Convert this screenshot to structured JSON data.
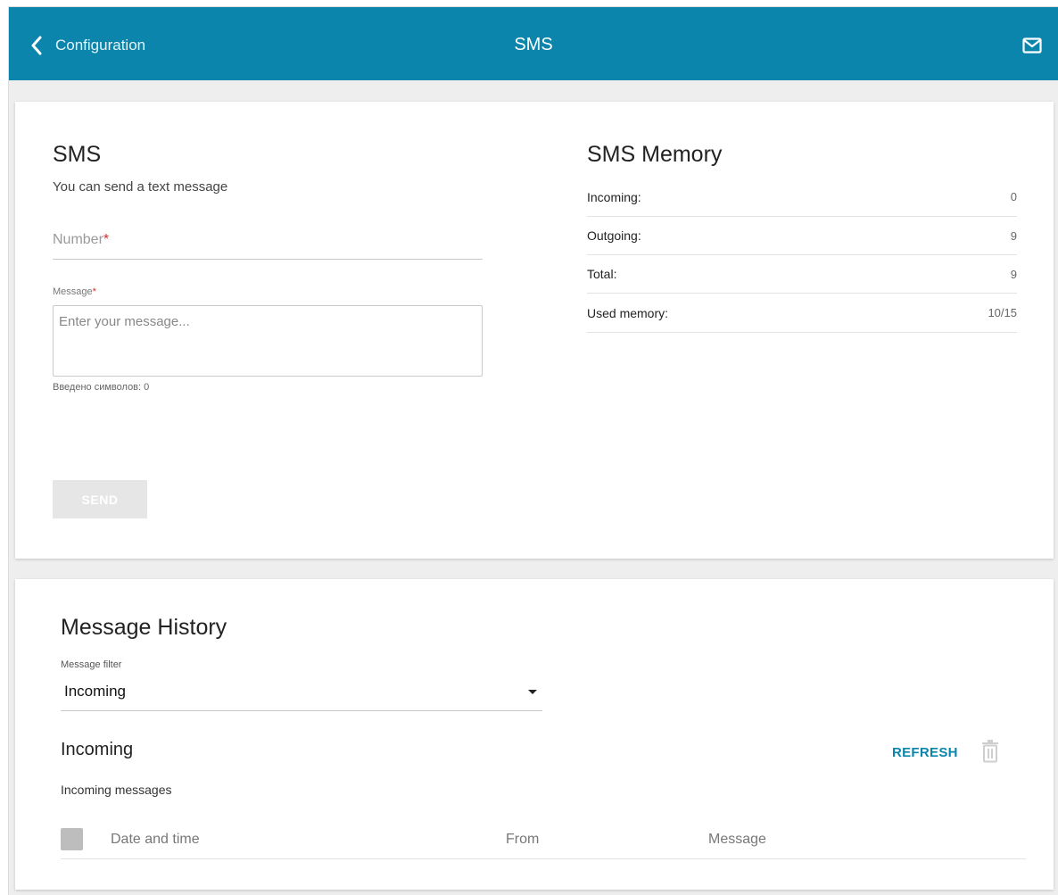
{
  "header": {
    "back_label": "Configuration",
    "title": "SMS",
    "background_color": "#0b85ab",
    "icons": [
      "chevron-left-icon",
      "mail-icon"
    ]
  },
  "sms": {
    "title": "SMS",
    "subtitle": "You can send a text message",
    "number_label": "Number",
    "required_mark": "*",
    "message_label": "Message",
    "message_placeholder": "Enter your message...",
    "message_value": "",
    "number_value": "",
    "char_count": "Введено символов: 0",
    "send_label": "SEND"
  },
  "memory": {
    "title": "SMS Memory",
    "rows": [
      {
        "label": "Incoming:",
        "value": "0"
      },
      {
        "label": "Outgoing:",
        "value": "9"
      },
      {
        "label": "Total:",
        "value": "9"
      },
      {
        "label": "Used memory:",
        "value": "10/15"
      }
    ]
  },
  "history": {
    "title": "Message History",
    "filter_label": "Message filter",
    "filter_value": "Incoming",
    "section_title": "Incoming",
    "refresh_label": "REFRESH",
    "section_subtitle": "Incoming messages",
    "columns": [
      "Date and time",
      "From",
      "Message"
    ],
    "accent_color": "#0b85ab"
  }
}
